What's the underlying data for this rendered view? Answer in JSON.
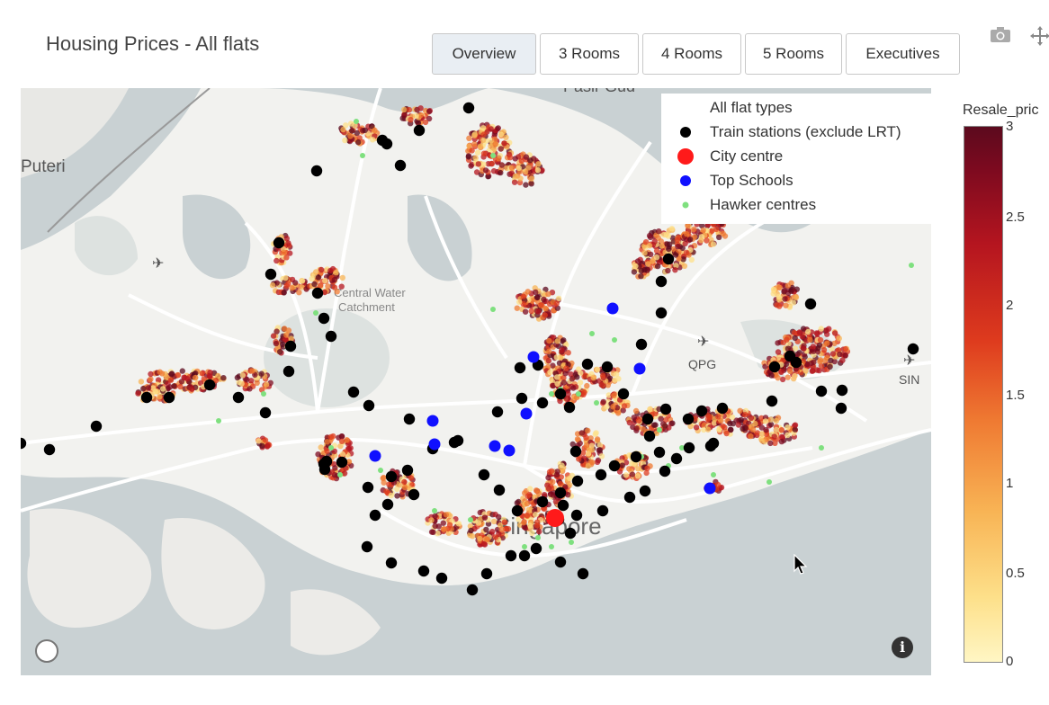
{
  "header": {
    "title": "Housing Prices - All flats",
    "tabs": [
      {
        "label": "Overview",
        "active": true
      },
      {
        "label": "3 Rooms",
        "active": false
      },
      {
        "label": "4 Rooms",
        "active": false
      },
      {
        "label": "5 Rooms",
        "active": false
      },
      {
        "label": "Executives",
        "active": false
      }
    ]
  },
  "toolbar": {
    "camera_icon": "camera-icon",
    "pan_icon": "pan-icon"
  },
  "map": {
    "labels": {
      "putteri": "Puteri",
      "central_water": "Central Water",
      "catchment": "Catchment",
      "qpg": "QPG",
      "sin": "SIN",
      "city": "Singapore",
      "top_cut": "Pasir Gud"
    },
    "colors": {
      "land": "#f2f2ef",
      "water": "#c9d1d3",
      "green": "#dde2e0",
      "roads": "#ffffff"
    }
  },
  "legend": {
    "items": [
      {
        "label": "All flat types",
        "symbol": "none"
      },
      {
        "label": "Train stations (exclude LRT)",
        "symbol": "dot",
        "color": "#000000"
      },
      {
        "label": "City centre",
        "symbol": "dot",
        "color": "#ff1a1a"
      },
      {
        "label": "Top Schools",
        "symbol": "dot",
        "color": "#1010ff"
      },
      {
        "label": "Hawker centres",
        "symbol": "dot",
        "color": "#7fe07f"
      }
    ]
  },
  "colorbar": {
    "title": "Resale_pric",
    "ticks": [
      "3",
      "2.5",
      "2",
      "1.5",
      "1",
      "0.5",
      "0"
    ],
    "range": [
      0,
      3
    ]
  },
  "buttons": {
    "info": "i"
  }
}
